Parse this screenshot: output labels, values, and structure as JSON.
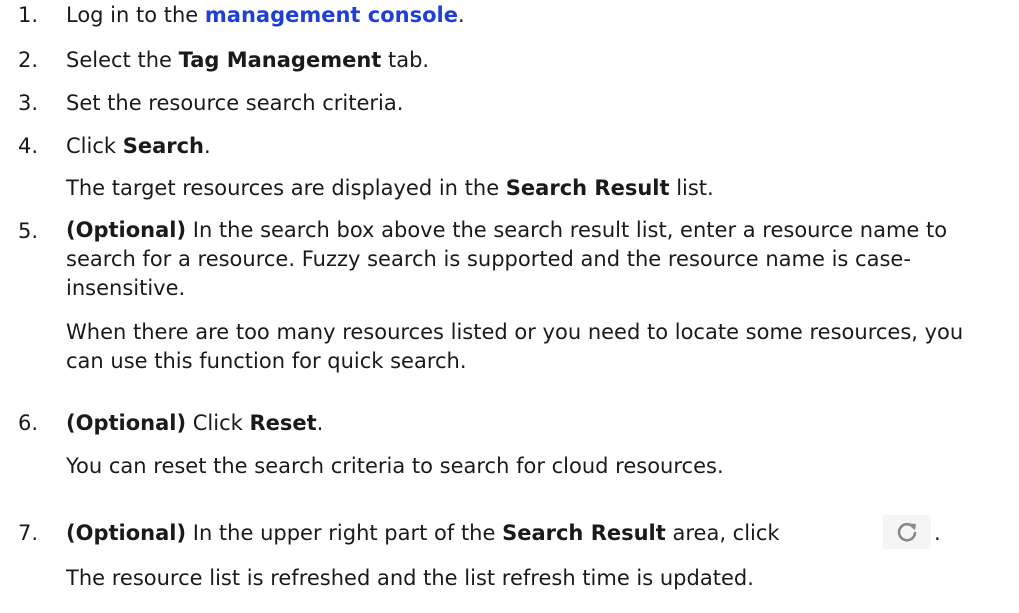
{
  "steps": [
    {
      "num": "1.",
      "pre": "Log in to the ",
      "link": "management console",
      "post": "."
    },
    {
      "num": "2.",
      "pre": "Select the ",
      "bold": "Tag Management",
      "post": " tab."
    },
    {
      "num": "3.",
      "text": "Set the resource search criteria."
    },
    {
      "num": "4.",
      "pre": "Click ",
      "bold": "Search",
      "post": ".",
      "sub_pre": "The target resources are displayed in the ",
      "sub_bold": "Search Result",
      "sub_post": " list."
    },
    {
      "num": "5.",
      "opt": "(Optional)",
      "text": " In the search box above the search result list, enter a resource name to search for a resource. Fuzzy search is supported and the resource name is case-insensitive.",
      "sub": "When there are too many resources listed or you need to locate some resources, you can use this function for quick search."
    },
    {
      "num": "6.",
      "opt": "(Optional)",
      "pre": " Click ",
      "bold": "Reset",
      "post": ".",
      "sub": "You can reset the search criteria to search for cloud resources."
    },
    {
      "num": "7.",
      "opt": "(Optional)",
      "pre": " In the upper right part of the ",
      "bold": "Search Result",
      "post": " area, click",
      "post2": ".",
      "sub": "The resource list is refreshed and the list refresh time is updated."
    }
  ],
  "icons": {
    "refresh": "refresh-icon"
  },
  "colors": {
    "link": "#1f3fd6",
    "icon_bg": "#f5f5f5",
    "icon": "#888888"
  }
}
